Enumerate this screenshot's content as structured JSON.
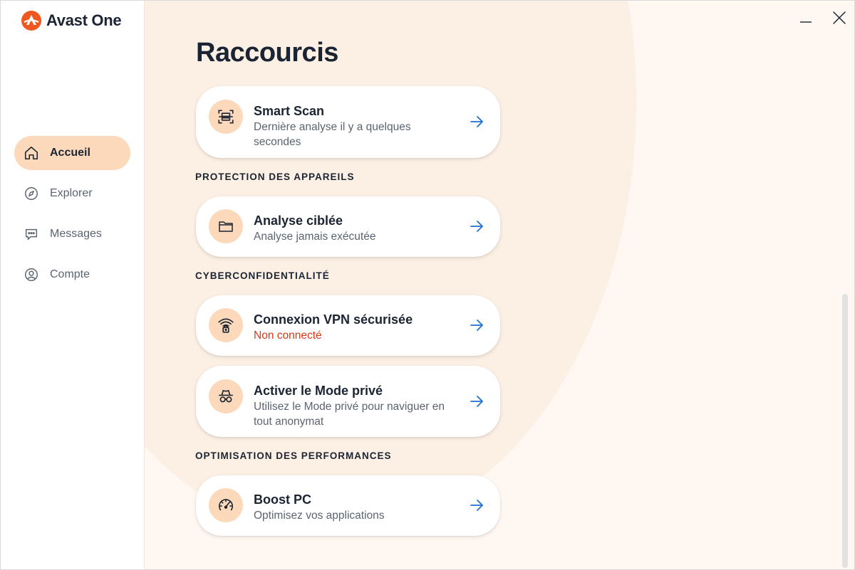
{
  "app": {
    "name": "Avast One",
    "brand_color": "#f0581f",
    "accent_color": "#fcd9bb"
  },
  "sidebar": {
    "items": [
      {
        "label": "Accueil",
        "icon": "home-icon",
        "active": true
      },
      {
        "label": "Explorer",
        "icon": "compass-icon",
        "active": false
      },
      {
        "label": "Messages",
        "icon": "chat-bubble-icon",
        "active": false
      },
      {
        "label": "Compte",
        "icon": "user-circle-icon",
        "active": false
      }
    ]
  },
  "main": {
    "title": "Raccourcis",
    "sections": {
      "device_protection": "PROTECTION DES APPAREILS",
      "privacy": "CYBERCONFIDENTIALITÉ",
      "performance": "OPTIMISATION DES PERFORMANCES"
    },
    "cards": {
      "smart_scan": {
        "title": "Smart Scan",
        "subtitle": "Dernière analyse il y a quelques secondes",
        "icon": "scan-icon"
      },
      "targeted_scan": {
        "title": "Analyse ciblée",
        "subtitle": "Analyse jamais exécutée",
        "icon": "folder-icon"
      },
      "vpn": {
        "title": "Connexion VPN sécurisée",
        "subtitle": "Non connecté",
        "icon": "wifi-lock-icon",
        "status_color": "#d13a1a"
      },
      "private_mode": {
        "title": "Activer le Mode privé",
        "subtitle": "Utilisez le Mode privé pour naviguer en tout anonymat",
        "icon": "incognito-icon"
      },
      "boost_pc": {
        "title": "Boost PC",
        "subtitle": "Optimisez vos applications",
        "icon": "speedometer-icon"
      }
    }
  },
  "window_controls": {
    "minimize_icon": "minimize-icon",
    "close_icon": "close-icon"
  }
}
